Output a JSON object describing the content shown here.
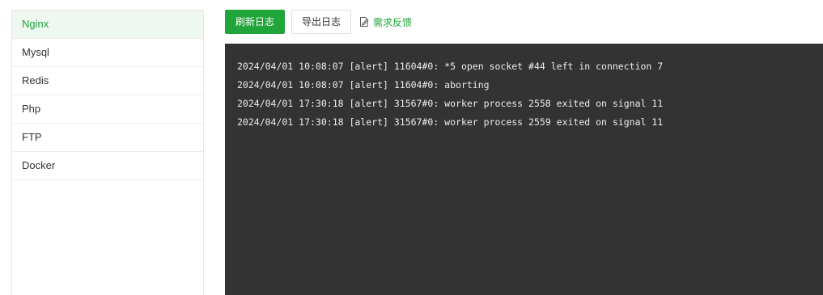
{
  "sidebar": {
    "items": [
      {
        "label": "Nginx",
        "active": true
      },
      {
        "label": "Mysql",
        "active": false
      },
      {
        "label": "Redis",
        "active": false
      },
      {
        "label": "Php",
        "active": false
      },
      {
        "label": "FTP",
        "active": false
      },
      {
        "label": "Docker",
        "active": false
      }
    ]
  },
  "toolbar": {
    "refresh_label": "刷新日志",
    "export_label": "导出日志",
    "feedback_label": "需求反馈",
    "feedback_icon": "edit-icon"
  },
  "log": {
    "lines": [
      "2024/04/01 10:08:07 [alert] 11604#0: *5 open socket #44 left in connection 7",
      "2024/04/01 10:08:07 [alert] 11604#0: aborting",
      "2024/04/01 17:30:18 [alert] 31567#0: worker process 2558 exited on signal 11",
      "2024/04/01 17:30:18 [alert] 31567#0: worker process 2559 exited on signal 11"
    ]
  },
  "colors": {
    "accent": "#20a53a",
    "log_background": "#333333",
    "log_text": "#ececec"
  }
}
